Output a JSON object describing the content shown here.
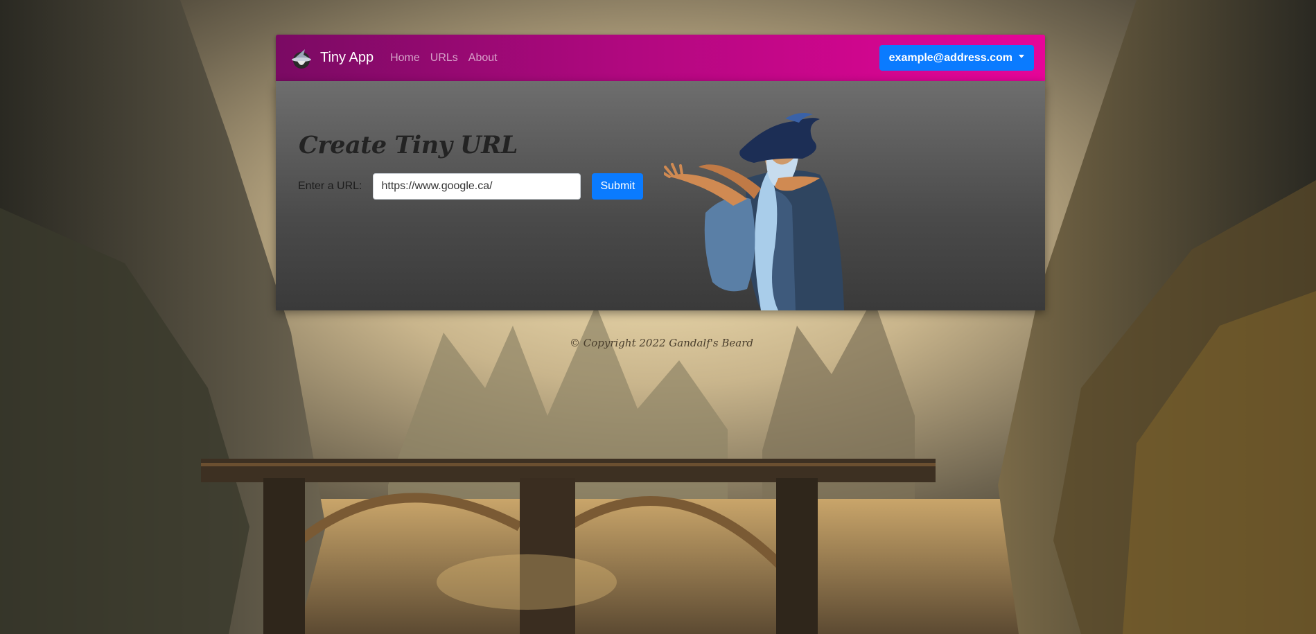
{
  "navbar": {
    "brand": "Tiny App",
    "links": [
      "Home",
      "URLs",
      "About"
    ],
    "user_email": "example@address.com"
  },
  "main": {
    "title": "Create Tiny URL",
    "url_label": "Enter a URL:",
    "url_value": "https://www.google.ca/",
    "submit_label": "Submit"
  },
  "footer": {
    "copyright": "© Copyright 2022 Gandalf's Beard"
  },
  "colors": {
    "navbar_gradient_start": "#7a0a63",
    "navbar_gradient_end": "#e60598",
    "primary_button": "#0a7bff",
    "card_top": "#6e6e6e",
    "card_bottom": "#3a3a3a"
  },
  "icons": {
    "brand": "wizard-hat-icon",
    "dropdown": "caret-down-icon"
  }
}
